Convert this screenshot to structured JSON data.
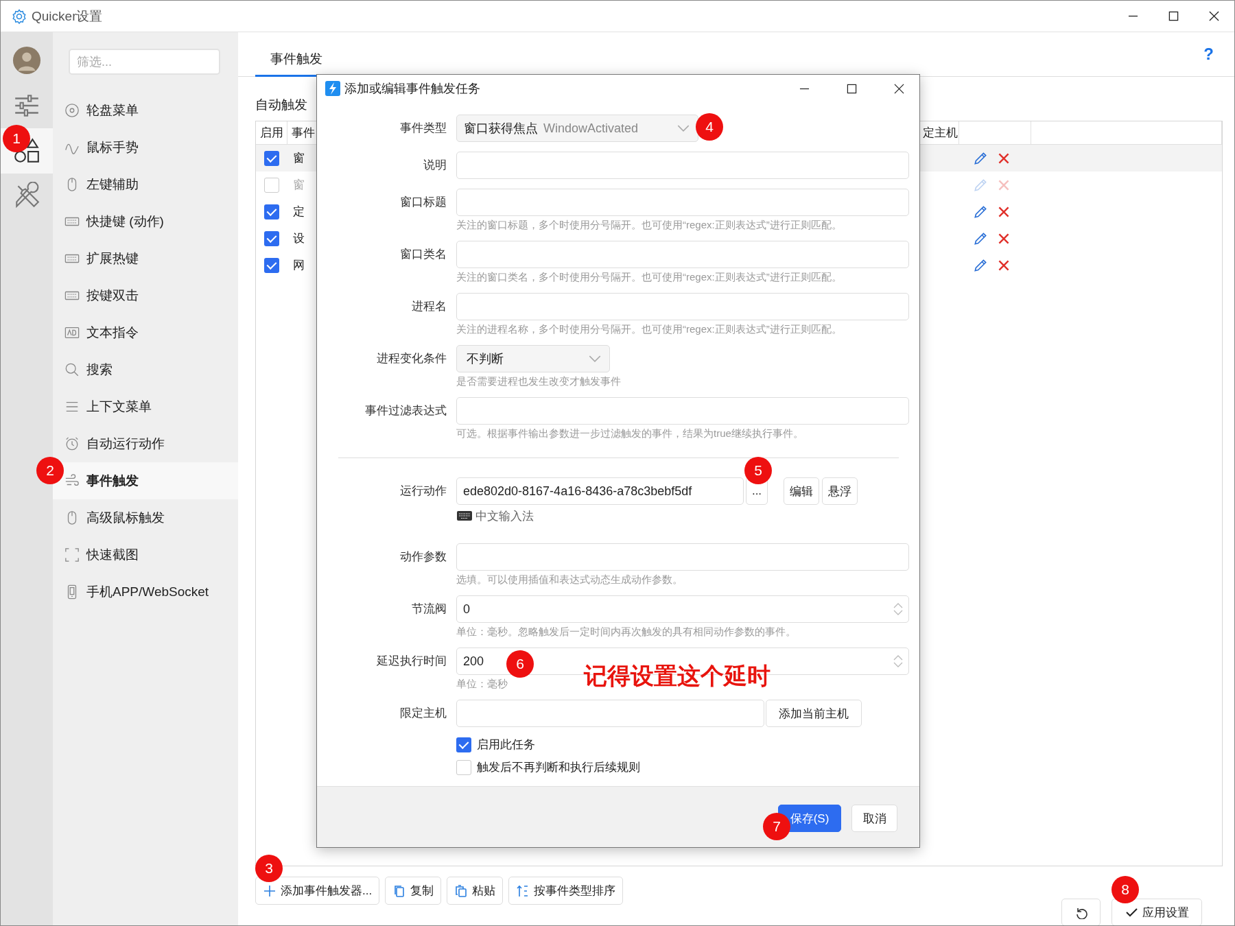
{
  "window": {
    "title": "Quicker设置"
  },
  "rail": {
    "items": [
      {
        "selected": false
      },
      {
        "selected": false
      },
      {
        "selected": true
      },
      {
        "selected": false
      }
    ]
  },
  "sidebar": {
    "filter": {
      "placeholder": "筛选..."
    },
    "items": [
      {
        "label": "轮盘菜单",
        "selected": false
      },
      {
        "label": "鼠标手势",
        "selected": false
      },
      {
        "label": "左键辅助",
        "selected": false
      },
      {
        "label": "快捷键 (动作)",
        "selected": false
      },
      {
        "label": "扩展热键",
        "selected": false
      },
      {
        "label": "按键双击",
        "selected": false
      },
      {
        "label": "文本指令",
        "selected": false
      },
      {
        "label": "搜索",
        "selected": false
      },
      {
        "label": "上下文菜单",
        "selected": false
      },
      {
        "label": "自动运行动作",
        "selected": false
      },
      {
        "label": "事件触发",
        "selected": true
      },
      {
        "label": "高级鼠标触发",
        "selected": false
      },
      {
        "label": "快速截图",
        "selected": false
      },
      {
        "label": "手机APP/WebSocket",
        "selected": false
      }
    ]
  },
  "tabs": [
    {
      "label": "事件触发",
      "selected": true
    }
  ],
  "help": "?",
  "section_label": "自动触发",
  "table": {
    "columns": [
      "启用",
      "事件",
      "定主机"
    ],
    "rows": [
      {
        "enabled": true,
        "selected": true,
        "event": "窗"
      },
      {
        "enabled": false,
        "selected": false,
        "event": "窗"
      },
      {
        "enabled": true,
        "selected": false,
        "event": "定"
      },
      {
        "enabled": true,
        "selected": false,
        "event": "设"
      },
      {
        "enabled": true,
        "selected": false,
        "event": "网"
      }
    ]
  },
  "toolbar": [
    "添加事件触发器...",
    "复制",
    "粘贴",
    "按事件类型排序"
  ],
  "apply_button": "应用设置",
  "dialog": {
    "title": "添加或编辑事件触发任务",
    "sections": [
      {
        "fields": [
          {
            "kind": "select",
            "label": "事件类型",
            "value": "窗口获得焦点",
            "note": "WindowActivated"
          },
          {
            "kind": "text",
            "label": "说明"
          },
          {
            "kind": "text",
            "label": "窗口标题",
            "hint": "关注的窗口标题，多个时使用分号隔开。也可使用“regex:正则表达式”进行正则匹配。"
          },
          {
            "kind": "text",
            "label": "窗口类名",
            "hint": "关注的窗口类名，多个时使用分号隔开。也可使用“regex:正则表达式”进行正则匹配。"
          },
          {
            "kind": "text",
            "label": "进程名",
            "hint": "关注的进程名称，多个时使用分号隔开。也可使用“regex:正则表达式”进行正则匹配。"
          },
          {
            "kind": "combo",
            "label": "进程变化条件",
            "value": "不判断",
            "hint": "是否需要进程也发生改变才触发事件"
          },
          {
            "kind": "text",
            "label": "事件过滤表达式",
            "hint": "可选。根据事件输出参数进一步过滤触发的事件，结果为true继续执行事件。"
          }
        ]
      },
      {
        "fields": [
          {
            "kind": "action",
            "label": "运行动作",
            "value": "ede802d0-8167-4a16-8436-a78c3bebf5df",
            "browse": "...",
            "buttons": [
              "编辑",
              "悬浮"
            ],
            "input_method": "中文输入法"
          },
          {
            "kind": "text",
            "label": "动作参数",
            "hint": "选填。可以使用插值和表达式动态生成动作参数。"
          },
          {
            "kind": "number",
            "label": "节流阀",
            "value": "0",
            "hint": "单位：毫秒。忽略触发后一定时间内再次触发的具有相同动作参数的事件。"
          },
          {
            "kind": "number",
            "label": "延迟执行时间",
            "value": "200",
            "hint": "单位：毫秒"
          },
          {
            "kind": "host",
            "label": "限定主机",
            "button": "添加当前主机"
          }
        ]
      }
    ],
    "checkboxes": [
      {
        "label": "启用此任务",
        "checked": true
      },
      {
        "label": "触发后不再判断和执行后续规则",
        "checked": false
      }
    ],
    "buttons": [
      {
        "label": "保存(S)",
        "primary": true
      },
      {
        "label": "取消",
        "primary": false
      }
    ]
  },
  "note": "记得设置这个延时",
  "badges": [
    "1",
    "2",
    "3",
    "4",
    "5",
    "6",
    "7",
    "8"
  ]
}
